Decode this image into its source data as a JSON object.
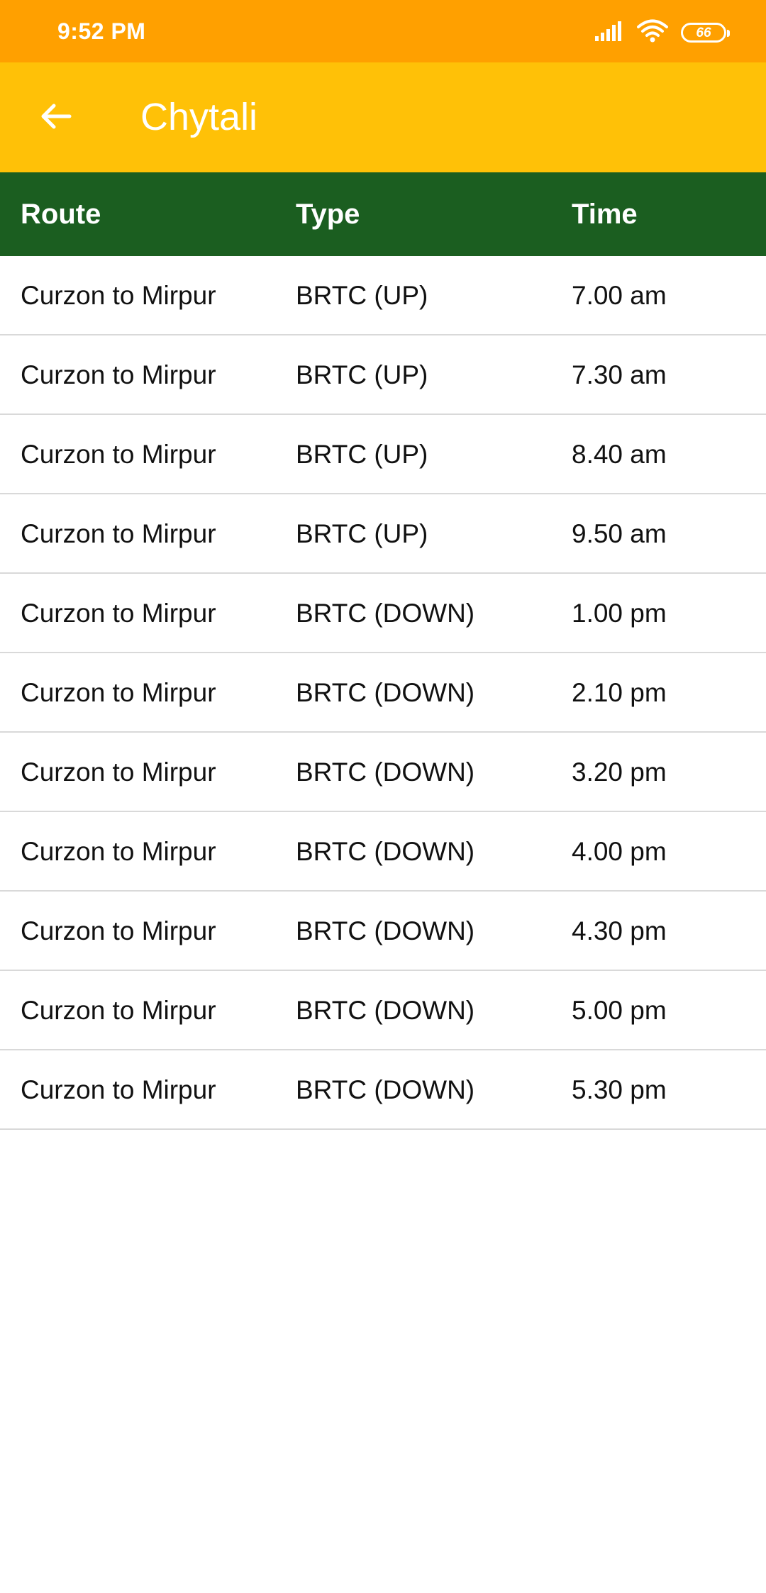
{
  "status_bar": {
    "time": "9:52 PM",
    "battery": "66",
    "icons": [
      "signal-icon",
      "wifi-icon",
      "battery-icon"
    ]
  },
  "app_bar": {
    "title": "Chytali",
    "back_icon": "back-arrow-icon"
  },
  "colors": {
    "status_bar": "#FFA000",
    "app_bar": "#FFC107",
    "table_header": "#1B5E20"
  },
  "table": {
    "headers": [
      "Route",
      "Type",
      "Time"
    ],
    "rows": [
      {
        "route": "Curzon to Mirpur",
        "type": "BRTC (UP)",
        "time": "7.00 am"
      },
      {
        "route": "Curzon to Mirpur",
        "type": "BRTC (UP)",
        "time": "7.30 am"
      },
      {
        "route": "Curzon to Mirpur",
        "type": "BRTC (UP)",
        "time": "8.40 am"
      },
      {
        "route": "Curzon to Mirpur",
        "type": "BRTC (UP)",
        "time": "9.50 am"
      },
      {
        "route": "Curzon to Mirpur",
        "type": "BRTC (DOWN)",
        "time": "1.00 pm"
      },
      {
        "route": "Curzon to Mirpur",
        "type": "BRTC (DOWN)",
        "time": "2.10 pm"
      },
      {
        "route": "Curzon to Mirpur",
        "type": "BRTC (DOWN)",
        "time": "3.20 pm"
      },
      {
        "route": "Curzon to Mirpur",
        "type": "BRTC (DOWN)",
        "time": "4.00 pm"
      },
      {
        "route": "Curzon to Mirpur",
        "type": "BRTC (DOWN)",
        "time": "4.30 pm"
      },
      {
        "route": "Curzon to Mirpur",
        "type": "BRTC (DOWN)",
        "time": "5.00 pm"
      },
      {
        "route": "Curzon to Mirpur",
        "type": "BRTC (DOWN)",
        "time": "5.30 pm"
      }
    ]
  }
}
